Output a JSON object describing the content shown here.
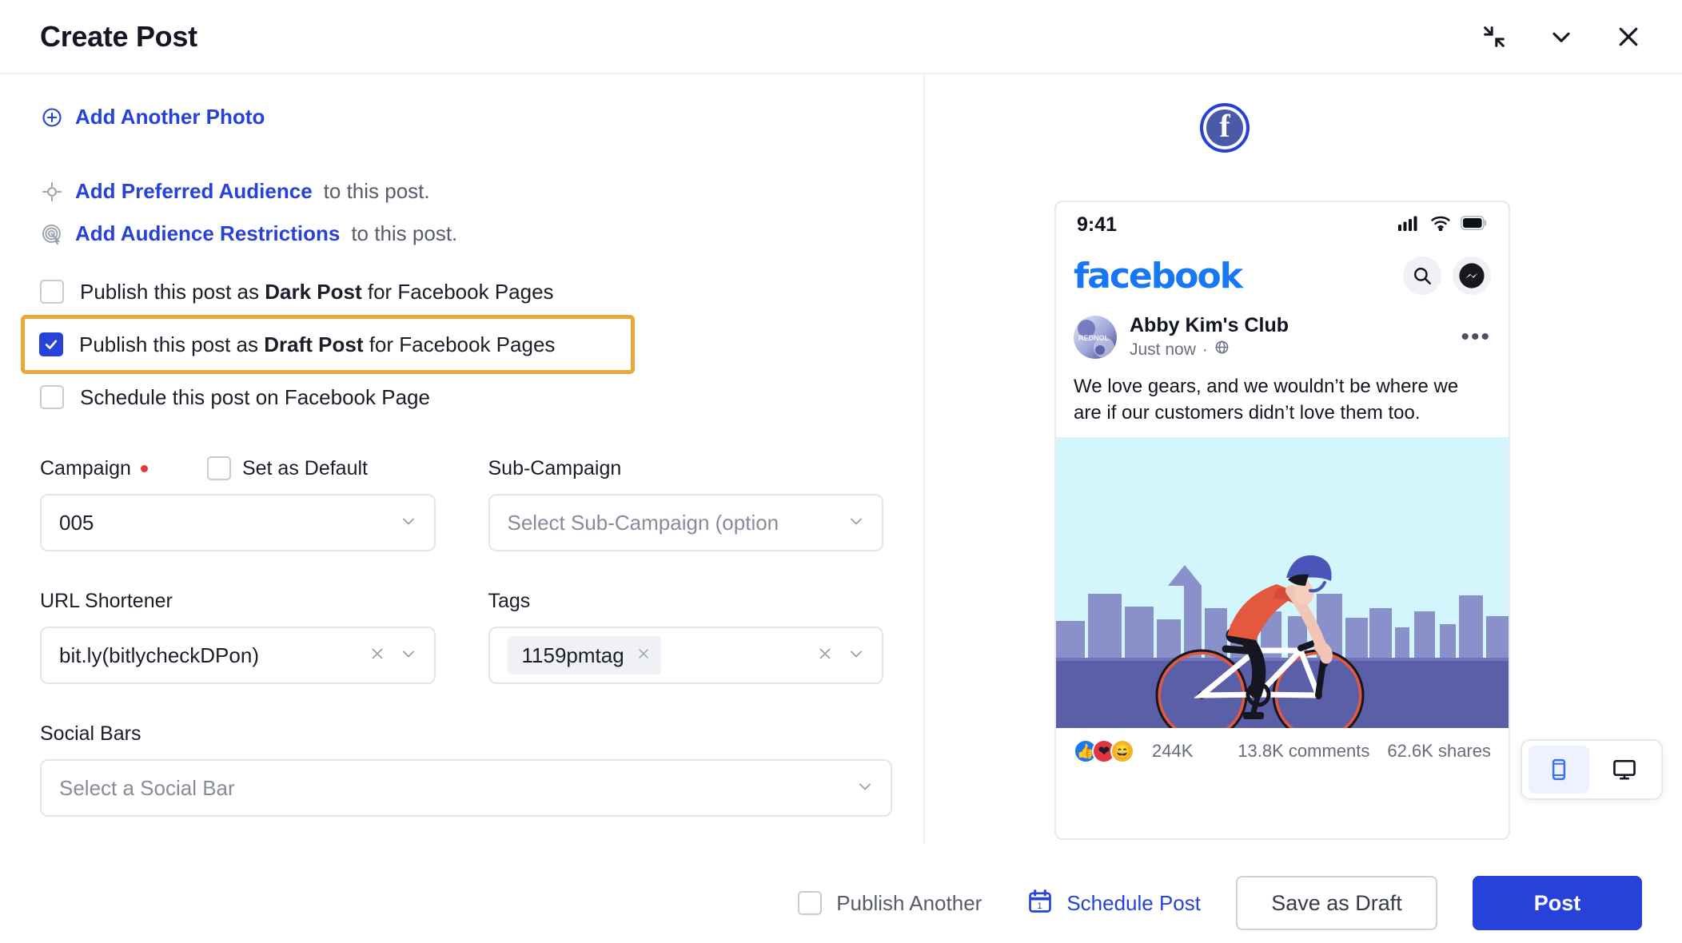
{
  "header": {
    "title": "Create Post",
    "icons": {
      "collapse": "collapse-arrows-icon",
      "chevron": "chevron-down-icon",
      "close": "close-icon"
    }
  },
  "left": {
    "add_photo": "Add Another Photo",
    "preferred_audience": {
      "link": "Add Preferred Audience",
      "rest": "to this post."
    },
    "audience_restrictions": {
      "link": "Add Audience Restrictions",
      "rest": "to this post."
    },
    "checkboxes": [
      {
        "pre": "Publish this post as ",
        "strong": "Dark Post",
        "post": " for Facebook Pages",
        "checked": false,
        "highlighted": false
      },
      {
        "pre": "Publish this post as ",
        "strong": "Draft Post",
        "post": " for Facebook Pages",
        "checked": true,
        "highlighted": true
      },
      {
        "pre": "Schedule this post on Facebook Page",
        "strong": "",
        "post": "",
        "checked": false,
        "highlighted": false
      }
    ],
    "campaign": {
      "label": "Campaign",
      "required": true,
      "value": "005"
    },
    "set_as_default": {
      "label": "Set as Default",
      "checked": false
    },
    "sub_campaign": {
      "label": "Sub-Campaign",
      "placeholder": "Select Sub-Campaign (option"
    },
    "url_shortener": {
      "label": "URL Shortener",
      "value": "bit.ly(bitlycheckDPon)"
    },
    "tags": {
      "label": "Tags",
      "pills": [
        "1159pmtag"
      ]
    },
    "social_bars": {
      "label": "Social Bars",
      "placeholder": "Select a Social Bar"
    }
  },
  "preview": {
    "network_badge": "f",
    "status_time": "9:41",
    "fb_wordmark": "facebook",
    "page_name": "Abby Kim's Club",
    "post_time": "Just now",
    "privacy_icon": "globe-icon",
    "post_text": "We love gears, and we wouldn’t be where we are if our customers didn’t love them too.",
    "reactions_count": "244K",
    "comments": "13.8K comments",
    "shares": "62.6K shares",
    "view_modes": [
      {
        "name": "mobile",
        "active": true
      },
      {
        "name": "desktop",
        "active": false
      }
    ]
  },
  "footer": {
    "publish_another": {
      "label": "Publish Another",
      "checked": false
    },
    "schedule_post": "Schedule Post",
    "calendar_day": "1",
    "save_draft": "Save as Draft",
    "post": "Post"
  },
  "colors": {
    "accent_blue": "#2742d8",
    "highlight_orange": "#e8a93a",
    "fb_blue": "#1877f2",
    "required_red": "#e03a3a"
  }
}
